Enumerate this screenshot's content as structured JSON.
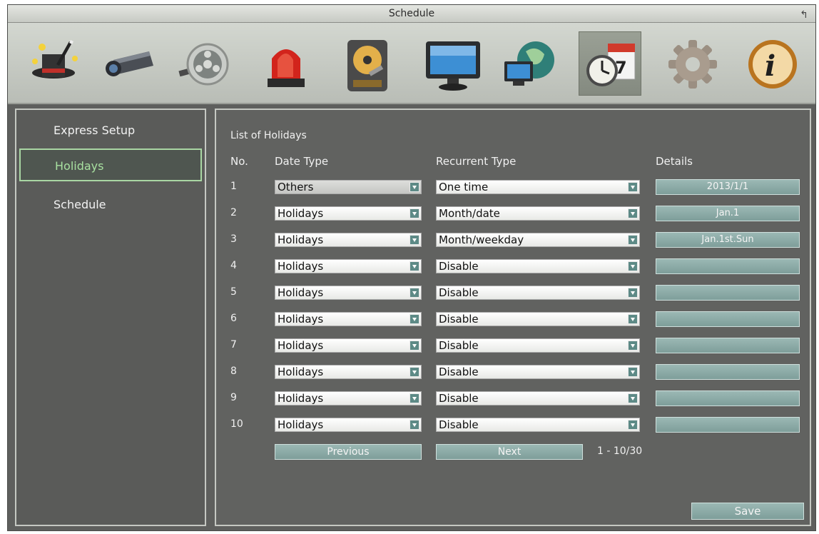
{
  "window": {
    "title": "Schedule"
  },
  "toolbar": {
    "icons": [
      {
        "name": "express-setup-wizard-icon"
      },
      {
        "name": "camera-icon"
      },
      {
        "name": "record-reel-icon"
      },
      {
        "name": "alarm-siren-icon"
      },
      {
        "name": "hard-disk-icon"
      },
      {
        "name": "monitor-icon"
      },
      {
        "name": "network-globe-icon"
      },
      {
        "name": "schedule-calendar-icon",
        "selected": true
      },
      {
        "name": "system-gear-icon"
      },
      {
        "name": "info-icon"
      }
    ]
  },
  "sidebar": {
    "items": [
      {
        "label": "Express Setup"
      },
      {
        "label": "Holidays",
        "active": true
      },
      {
        "label": "Schedule"
      }
    ]
  },
  "holidays": {
    "title": "List of Holidays",
    "columns": {
      "no": "No.",
      "date_type": "Date Type",
      "recurrent_type": "Recurrent Type",
      "details": "Details"
    },
    "rows": [
      {
        "no": "1",
        "date_type": "Others",
        "recurrent_type": "One time",
        "details": "2013/1/1"
      },
      {
        "no": "2",
        "date_type": "Holidays",
        "recurrent_type": "Month/date",
        "details": "Jan.1"
      },
      {
        "no": "3",
        "date_type": "Holidays",
        "recurrent_type": "Month/weekday",
        "details": "Jan.1st.Sun"
      },
      {
        "no": "4",
        "date_type": "Holidays",
        "recurrent_type": "Disable",
        "details": ""
      },
      {
        "no": "5",
        "date_type": "Holidays",
        "recurrent_type": "Disable",
        "details": ""
      },
      {
        "no": "6",
        "date_type": "Holidays",
        "recurrent_type": "Disable",
        "details": ""
      },
      {
        "no": "7",
        "date_type": "Holidays",
        "recurrent_type": "Disable",
        "details": ""
      },
      {
        "no": "8",
        "date_type": "Holidays",
        "recurrent_type": "Disable",
        "details": ""
      },
      {
        "no": "9",
        "date_type": "Holidays",
        "recurrent_type": "Disable",
        "details": ""
      },
      {
        "no": "10",
        "date_type": "Holidays",
        "recurrent_type": "Disable",
        "details": ""
      }
    ],
    "pagination": {
      "previous_label": "Previous",
      "next_label": "Next",
      "range_text": "1 - 10/30"
    },
    "save_label": "Save"
  }
}
